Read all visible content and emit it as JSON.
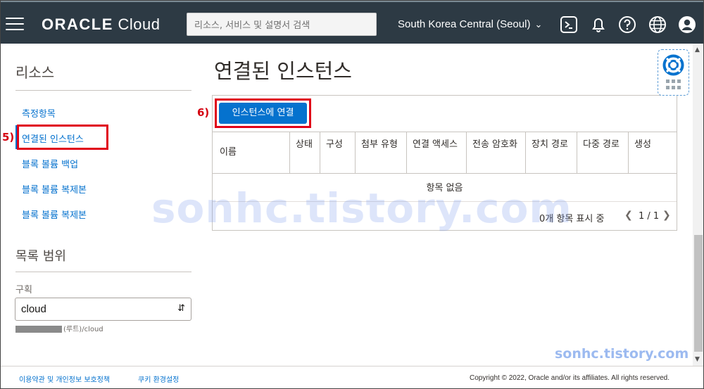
{
  "header": {
    "brand_bold": "ORACLE",
    "brand_light": " Cloud",
    "search_placeholder": "리소스, 서비스 및 설명서 검색",
    "region": "South Korea Central (Seoul)"
  },
  "sidebar": {
    "title": "리소스",
    "items": [
      {
        "label": "측정항목"
      },
      {
        "label": "연결된 인스턴스"
      },
      {
        "label": "블록 볼륨 백업"
      },
      {
        "label": "블록 볼륨 복제본"
      },
      {
        "label": "블록 볼륨 복제본"
      }
    ],
    "scope_title": "목록 범위",
    "compartment_label": "구획",
    "compartment_value": "cloud",
    "compartment_path": "(루트)/cloud"
  },
  "annotations": {
    "step5": "5)",
    "step6": "6)"
  },
  "main": {
    "title": "연결된 인스턴스",
    "attach_button": "인스턴스에 연결",
    "columns": [
      "이름",
      "상태",
      "구성",
      "첨부 유형",
      "연결 액세스",
      "전송 암호화",
      "장치 경로",
      "다중 경로",
      "생성"
    ],
    "empty_text": "항목 없음",
    "items_shown": "0개 항목 표시 중",
    "page": "1 / 1"
  },
  "watermark": {
    "big": "sonhc.tistory.com",
    "small": "sonhc.tistory.com"
  },
  "footer": {
    "terms": "이용약관 및 개인정보 보호정책",
    "cookies": "쿠키 환경설정",
    "copyright": "Copyright © 2022, Oracle and/or its affiliates. All rights reserved."
  },
  "colors": {
    "header_bg": "#2d3a44",
    "link": "#0572ce",
    "button": "#0572ce",
    "highlight": "#e00019"
  },
  "icons": [
    "menu-icon",
    "cloud-shell-icon",
    "bell-icon",
    "help-icon",
    "globe-icon",
    "profile-icon",
    "lifebuoy-icon",
    "chevron-down-icon"
  ]
}
